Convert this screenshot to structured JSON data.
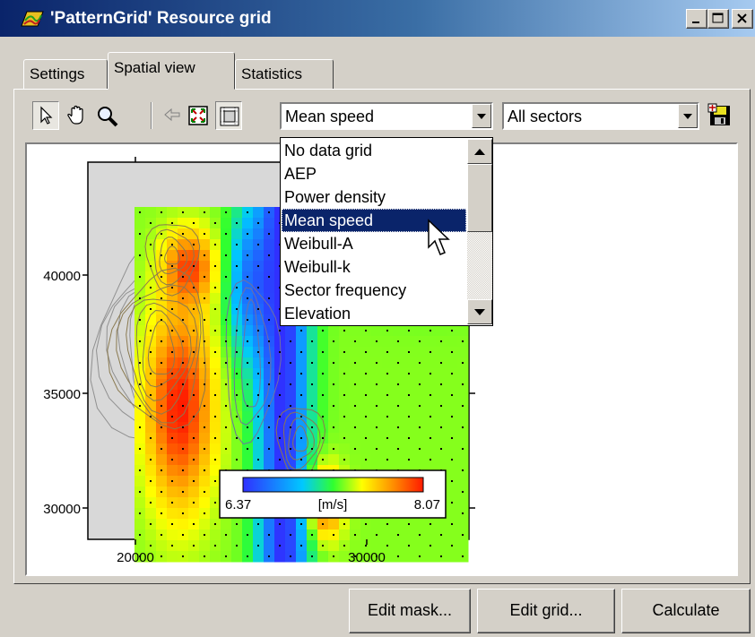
{
  "window": {
    "title": "'PatternGrid' Resource grid",
    "controls": {
      "minimize_icon": "minimize-icon",
      "maximize_icon": "maximize-icon",
      "close_icon": "close-icon"
    }
  },
  "tabs": [
    {
      "label": "Settings",
      "active": false
    },
    {
      "label": "Spatial view",
      "active": true
    },
    {
      "label": "Statistics",
      "active": false
    }
  ],
  "toolbar": {
    "tools": [
      "select-arrow-icon",
      "pan-hand-icon",
      "zoom-magnifier-icon",
      "back-arrow-icon",
      "zoom-extents-icon",
      "zoom-grid-icon"
    ],
    "variable_select": {
      "value": "Mean speed"
    },
    "sector_select": {
      "value": "All sectors"
    },
    "save_icon": "save-disk-icon"
  },
  "dropdown": {
    "options": [
      "No data grid",
      "AEP",
      "Power density",
      "Mean speed",
      "Weibull-A",
      "Weibull-k",
      "Sector frequency",
      "Elevation"
    ],
    "selected": "Mean speed"
  },
  "map": {
    "y_ticks": [
      "40000",
      "35000",
      "30000"
    ],
    "x_ticks": [
      "20000",
      "30000"
    ],
    "legend": {
      "min": "6.37",
      "unit": "[m/s]",
      "max": "8.07"
    },
    "colors": {
      "low": "#3030ff",
      "mid": "#ffff00",
      "high": "#ff1a00",
      "background": "#d8d8d8"
    }
  },
  "buttons": {
    "edit_mask": "Edit mask...",
    "edit_grid": "Edit grid...",
    "calculate": "Calculate"
  }
}
